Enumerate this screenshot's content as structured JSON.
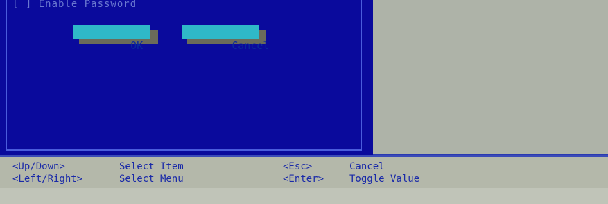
{
  "dialog": {
    "checkbox_label": "[ ] Enable Password",
    "ok_button": "OK",
    "cancel_button": "Cancel"
  },
  "help": {
    "rows": [
      {
        "key1": "<Up/Down>",
        "action1": "Select Item",
        "key2": "<Esc>",
        "action2": "Cancel"
      },
      {
        "key1": "<Left/Right>",
        "action1": "Select Menu",
        "key2": "<Enter>",
        "action2": "Toggle Value"
      }
    ]
  },
  "colors": {
    "dialog_bg": "#0a0a9c",
    "button_bg": "#2fb8c8",
    "help_text": "#1a2aa8",
    "panel_gray": "#aeb3a8"
  }
}
